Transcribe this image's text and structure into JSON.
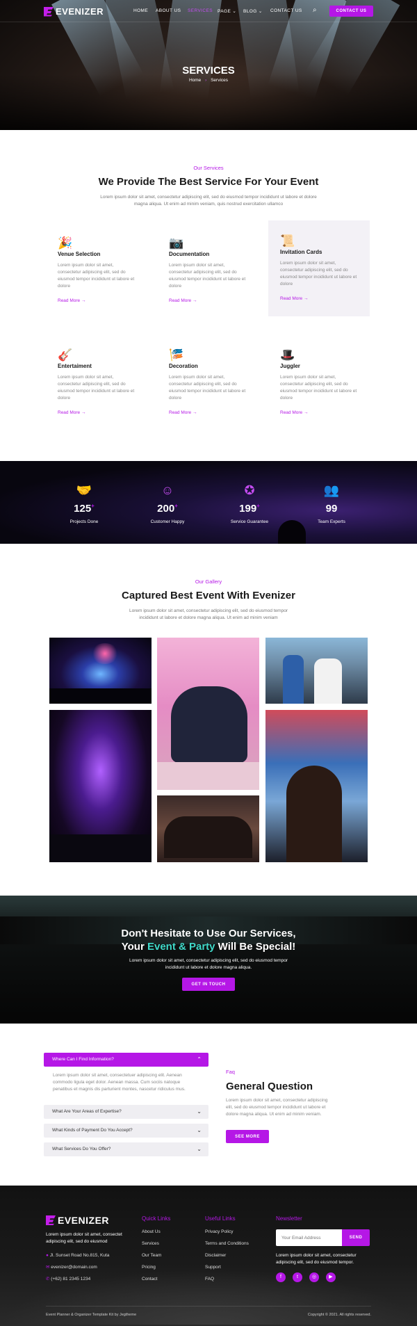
{
  "brand": {
    "name": "EVENIZER",
    "accent": "#b517e6"
  },
  "nav": {
    "items": [
      "HOME",
      "ABOUT US",
      "SERVICES",
      "PAGE",
      "BLOG",
      "CONTACT US"
    ],
    "active": "SERVICES",
    "contact_button": "CONTACT US"
  },
  "hero": {
    "title": "SERVICES",
    "breadcrumb_home": "Home",
    "breadcrumb_current": "Services"
  },
  "services": {
    "tag": "Our Services",
    "title": "We Provide The Best Service For Your Event",
    "desc_line1": "Lorem ipsum dolor sit amet, consectetur adipiscing elit, sed do eiusmod tempor incididunt ut labore et dolore",
    "desc_line2": "magna aliqua. Ut enim ad minim veniam, quis nostrud exercitation ullamco",
    "card_desc": "Lorem ipsum dolor sit amet, consectetur adipiscing elit, sed do eiusmod tempor incididunt ut labore et dolore",
    "read_more": "Read More",
    "items": [
      {
        "title": "Venue Selection",
        "icon": "party-popper-icon"
      },
      {
        "title": "Documentation",
        "icon": "camera-icon"
      },
      {
        "title": "Invitation Cards",
        "icon": "invitation-card-icon"
      },
      {
        "title": "Entertaiment",
        "icon": "guitar-icon"
      },
      {
        "title": "Decoration",
        "icon": "bunting-icon"
      },
      {
        "title": "Juggler",
        "icon": "magic-hat-icon"
      }
    ]
  },
  "stats": [
    {
      "value": "125",
      "label": "Projects Done",
      "icon": "handshake-icon",
      "plus": "+"
    },
    {
      "value": "200",
      "label": "Customer Happy",
      "icon": "smile-icon",
      "plus": "+"
    },
    {
      "value": "199",
      "label": "Service Guarantee",
      "icon": "badge-icon",
      "plus": "+"
    },
    {
      "value": "99",
      "label": "Team Experts",
      "icon": "team-icon",
      "plus": ""
    }
  ],
  "gallery": {
    "tag": "Our Gallery",
    "title": "Captured Best Event With Evenizer",
    "desc_line1": "Lorem ipsum dolor sit amet, consectetur adipiscing elit, sed do eiusmod tempor",
    "desc_line2": "incididunt ut labore et dolore magna aliqua. Ut enim ad minim veniam"
  },
  "cta": {
    "line1": "Don't Hesitate to Use Our Services,",
    "line2_a": "Your ",
    "line2_highlight": "Event & Party",
    "line2_b": " Will Be Special!",
    "highlight_color": "#3fd9c9",
    "desc_line1": "Lorem ipsum dolor sit amet, consectetur adipiscing elit, sed do eiusmod tempor",
    "desc_line2": "incididunt ut labore et dolore magna aliqua.",
    "button": "GET IN TOUCH"
  },
  "faq": {
    "open_question": "Where Can I Find Information?",
    "open_answer_1": "Lorem ipsum dolor sit amet, consectetuer adipiscing elit. Aenean",
    "open_answer_2": "commodo ligula eget dolor. Aenean massa. Cum sociis natoque",
    "open_answer_3": "penatibus et magnis dis parturient montes, nascetur ridiculus mus.",
    "questions": [
      "What Are Your Areas of Expertise?",
      "What Kinds of Payment Do You Accept?",
      "What Services Do You Offer?"
    ],
    "tag": "Faq",
    "title": "General Question",
    "desc_line1": "Lorem ipsum dolor sit amet, consectetur adipiscing",
    "desc_line2": "elit, sed do eiusmod tempor incididunt ut labore et",
    "desc_line3": "dolore magna aliqua. Ut enim ad minim veniam.",
    "button": "SEE MORE"
  },
  "footer": {
    "about_1": "Lorem ipsum dolor sit amet, consectet",
    "about_2": "adipiscing elit, sed do eiusmod",
    "address": "Jl. Sunset Road No.815, Kuta",
    "email": "evenizer@domain.com",
    "phone": "(+62) 81 2345 1234",
    "quick_links_title": "Quick Links",
    "quick_links": [
      "About Us",
      "Services",
      "Our Team",
      "Pricing",
      "Contact"
    ],
    "useful_links_title": "Useful Links",
    "useful_links": [
      "Privacy Policy",
      "Terms and Conditions",
      "Disclaimer",
      "Support",
      "FAQ"
    ],
    "newsletter_title": "Newsletter",
    "email_placeholder": "Your Email Address",
    "send": "SEND",
    "newsletter_desc_1": "Lorem ipsum dolor sit amet, consectetur",
    "newsletter_desc_2": "adipiscing elit, sed do eiusmod tempor.",
    "socials": [
      "facebook-icon",
      "twitter-icon",
      "instagram-icon",
      "youtube-icon"
    ],
    "credit": "Event Planner & Organizer Template Kit by Jegtheme",
    "copyright": "Copyright © 2021. All rights reserved."
  }
}
